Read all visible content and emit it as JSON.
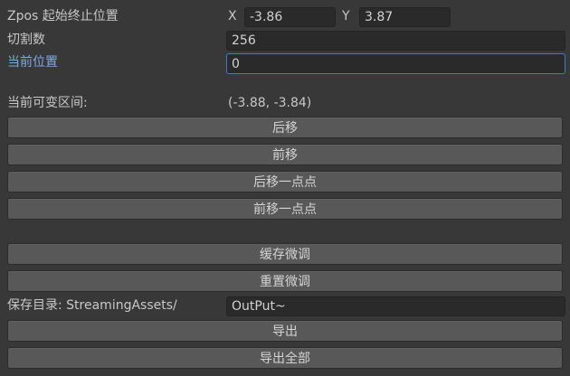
{
  "zpos": {
    "label": "Zpos 起始终止位置",
    "x_label": "X",
    "x_value": "-3.86",
    "y_label": "Y",
    "y_value": "3.87"
  },
  "slices": {
    "label": "切割数",
    "value": "256"
  },
  "current_position": {
    "label": "当前位置",
    "value": "0"
  },
  "variable_range": {
    "label": "当前可变区间:",
    "value": "(-3.88, -3.84)"
  },
  "buttons": {
    "move_back": "后移",
    "move_forward": "前移",
    "move_back_bit": "后移一点点",
    "move_forward_bit": "前移一点点",
    "cache_tweak": "缓存微调",
    "reset_tweak": "重置微调",
    "export": "导出",
    "export_all": "导出全部"
  },
  "save_dir": {
    "label": "保存目录: StreamingAssets/",
    "value": "OutPut~"
  },
  "colors": {
    "background": "#383838",
    "field": "#2a2a2a",
    "button": "#585858",
    "focus_border": "#3d79d6",
    "active_label": "#7ea7e8"
  }
}
